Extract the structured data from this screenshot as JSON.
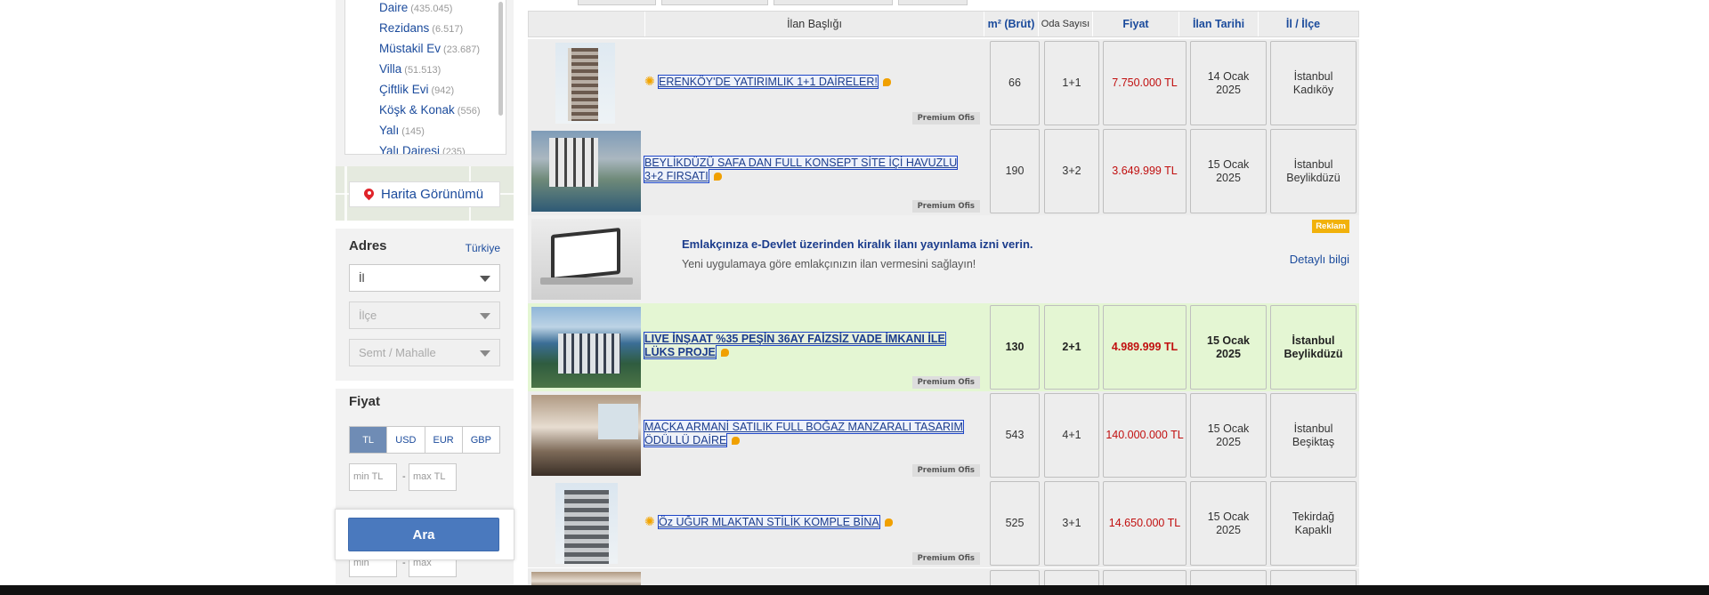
{
  "sidebar": {
    "categories": [
      {
        "label": "Daire",
        "count": "(435.045)"
      },
      {
        "label": "Rezidans",
        "count": "(6.517)"
      },
      {
        "label": "Müstakil Ev",
        "count": "(23.687)"
      },
      {
        "label": "Villa",
        "count": "(51.513)"
      },
      {
        "label": "Çiftlik Evi",
        "count": "(942)"
      },
      {
        "label": "Köşk & Konak",
        "count": "(556)"
      },
      {
        "label": "Yalı",
        "count": "(145)"
      },
      {
        "label": "Yalı Dairesi",
        "count": "(235)"
      }
    ],
    "map_button": "Harita Görünümü",
    "address": {
      "title": "Adres",
      "country_link": "Türkiye",
      "il_select": "İl",
      "ilce_select": "İlçe",
      "semt_select": "Semt / Mahalle"
    },
    "price": {
      "title": "Fiyat",
      "currencies": [
        "TL",
        "USD",
        "EUR",
        "GBP"
      ],
      "active_currency": "TL",
      "min_placeholder": "min TL",
      "max_placeholder": "max TL",
      "range_dash": "-"
    },
    "area": {
      "min_placeholder": "min",
      "max_placeholder": "max",
      "range_dash": "-"
    },
    "search_button": "Ara"
  },
  "table": {
    "headers": {
      "title": "İlan Başlığı",
      "area": "m² (Brüt)",
      "rooms": "Oda Sayısı",
      "price": "Fiyat",
      "date": "İlan Tarihi",
      "location": "İl / İlçe"
    },
    "premium_label": "Premium Ofis",
    "listings": [
      {
        "title": "ERENKÖY'DE YATIRIMLIK 1+1 DAİRELER!",
        "area": "66",
        "rooms": "1+1",
        "price": "7.750.000 TL",
        "date": "14 Ocak 2025",
        "location": "İstanbul Kadıköy"
      },
      {
        "title": "BEYLİKDÜZÜ SAFA DAN FULL KONSEPT SİTE İÇİ HAVUZLU 3+2 FIRSATI",
        "area": "190",
        "rooms": "3+2",
        "price": "3.649.999 TL",
        "date": "15 Ocak 2025",
        "location": "İstanbul Beylikdüzü"
      },
      {
        "title": "LIVE İNŞAAT %35 PEŞİN 36AY FAİZSİZ VADE İMKANI İLE LÜKS PROJE",
        "area": "130",
        "rooms": "2+1",
        "price": "4.989.999 TL",
        "date": "15 Ocak 2025",
        "location": "İstanbul Beylikdüzü"
      },
      {
        "title": "MAÇKA ARMANİ SATILIK FULL BOĞAZ MANZARALI TASARIM ÖDÜLLÜ DAİRE",
        "area": "543",
        "rooms": "4+1",
        "price": "140.000.000 TL",
        "date": "15 Ocak 2025",
        "location": "İstanbul Beşiktaş"
      },
      {
        "title": "Öz UĞUR MLAKTAN STİLİK KOMPLE BİNA",
        "area": "525",
        "rooms": "3+1",
        "price": "14.650.000 TL",
        "date": "15 Ocak 2025",
        "location": "Tekirdağ Kapaklı"
      }
    ],
    "ad": {
      "badge": "Reklam",
      "title": "Emlakçınıza e-Devlet üzerinden kiralık ilanı yayınlama izni verin.",
      "description": "Yeni uygulamaya göre emlakçınızın ilan vermesini sağlayın!",
      "link": "Detaylı bilgi"
    }
  },
  "colors": {
    "link_blue": "#1b4b9c",
    "price_red": "#c10f0f",
    "highlight_green": "#e4f6d3",
    "button_blue": "#4a79be",
    "ad_badge": "#f1b10b"
  },
  "icons": [
    "location-pin-icon",
    "dropdown-caret-icon",
    "star-icon",
    "message-icon"
  ]
}
